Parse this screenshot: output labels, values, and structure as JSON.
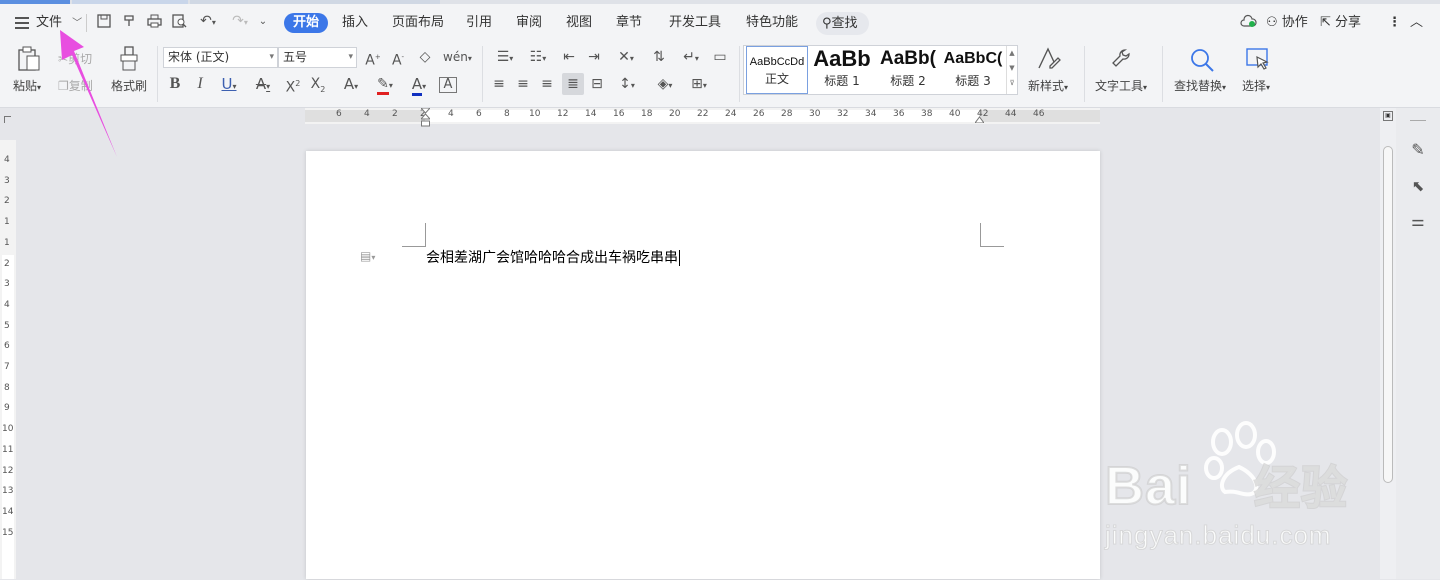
{
  "menubar": {
    "file_label": "文件",
    "tabs": [
      "开始",
      "插入",
      "页面布局",
      "引用",
      "审阅",
      "视图",
      "章节",
      "开发工具",
      "特色功能"
    ],
    "search_label": "查找",
    "collab_label": "协作",
    "share_label": "分享"
  },
  "ribbon": {
    "paste_label": "粘贴",
    "cut_label": "剪切",
    "copy_label": "复制",
    "format_painter_label": "格式刷",
    "font_name": "宋体 (正文)",
    "font_size": "五号",
    "styles": [
      {
        "preview": "AaBbCcDd",
        "name": "正文"
      },
      {
        "preview": "AaBb",
        "name": "标题 1"
      },
      {
        "preview": "AaBb(",
        "name": "标题 2"
      },
      {
        "preview": "AaBbC(",
        "name": "标题 3"
      }
    ],
    "new_style_label": "新样式",
    "text_tools_label": "文字工具",
    "find_replace_label": "查找替换",
    "select_label": "选择"
  },
  "ruler": {
    "h_ticks": [
      "6",
      "4",
      "2",
      "2",
      "4",
      "6",
      "8",
      "10",
      "12",
      "14",
      "16",
      "18",
      "20",
      "22",
      "24",
      "26",
      "28",
      "30",
      "32",
      "34",
      "36",
      "38",
      "40",
      "42",
      "44",
      "46"
    ],
    "v_ticks": [
      "4",
      "3",
      "2",
      "1",
      "1",
      "2",
      "3",
      "4",
      "5",
      "6",
      "7",
      "8",
      "9",
      "10",
      "11",
      "12",
      "13",
      "14",
      "15"
    ]
  },
  "document": {
    "body_text": "会相差湖广会馆哈哈哈合成出车祸吃串串"
  },
  "watermark": {
    "brand": "Bai",
    "brand_cn": "经验",
    "url": "jingyan.baidu.com"
  },
  "colors": {
    "accent": "#3c77e8",
    "arrow": "#e84ee0"
  }
}
